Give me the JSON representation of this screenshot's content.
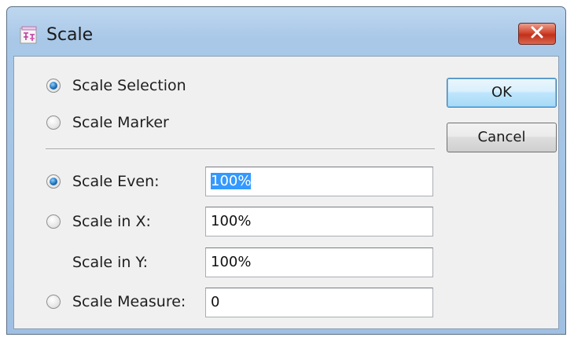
{
  "window": {
    "title": "Scale",
    "close_icon": "close-x-icon",
    "app_icon": "scale-app-icon"
  },
  "mode": {
    "options": [
      {
        "label": "Scale Selection",
        "checked": true
      },
      {
        "label": "Scale Marker",
        "checked": false
      }
    ]
  },
  "scale": {
    "even": {
      "label": "Scale Even:",
      "value": "100%",
      "checked": true
    },
    "in_x": {
      "label": "Scale in X:",
      "value": "100%",
      "checked": false
    },
    "in_y": {
      "label": "Scale in Y:",
      "value": "100%"
    },
    "measure": {
      "label": "Scale Measure:",
      "value": "0",
      "checked": false
    }
  },
  "buttons": {
    "ok": "OK",
    "cancel": "Cancel"
  },
  "colors": {
    "selection": "#3399ff",
    "close_button": "#c1301b"
  }
}
